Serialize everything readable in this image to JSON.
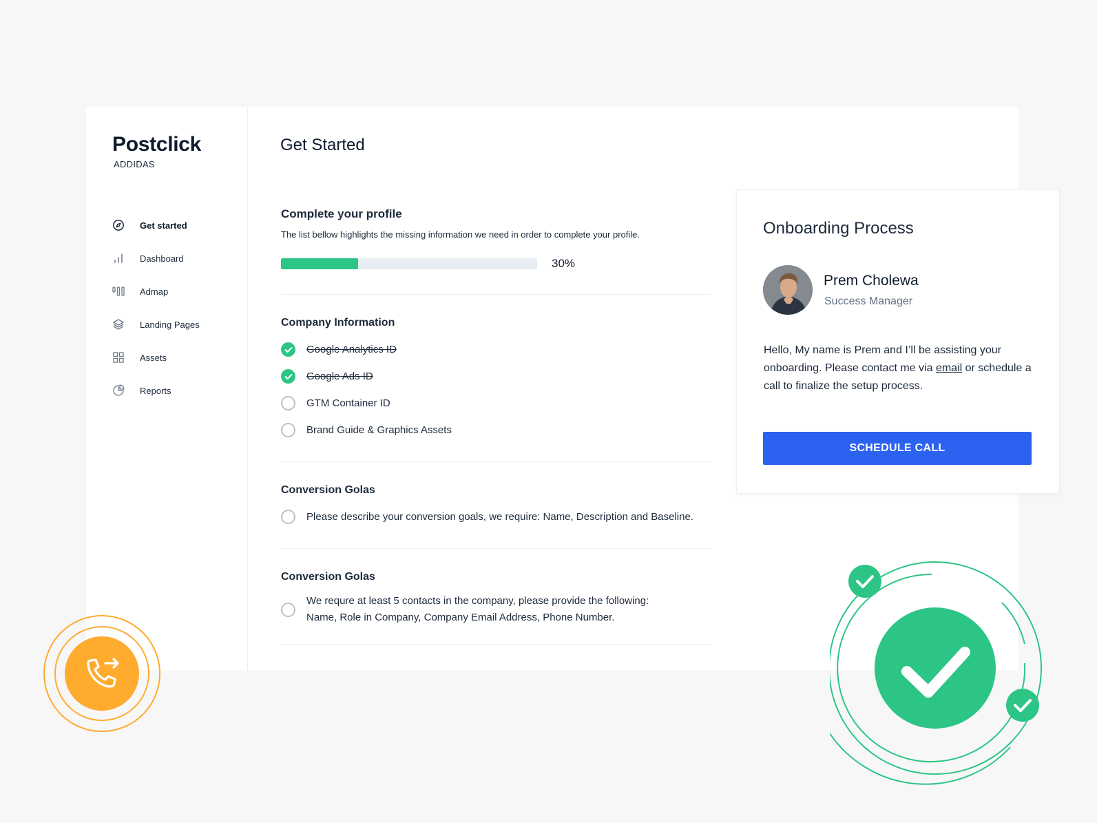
{
  "brand": {
    "name": "Postclick",
    "account": "ADDIDAS"
  },
  "sidebar": {
    "items": [
      {
        "label": "Get started",
        "icon": "compass-icon",
        "active": true
      },
      {
        "label": "Dashboard",
        "icon": "bar-chart-icon"
      },
      {
        "label": "Admap",
        "icon": "columns-icon"
      },
      {
        "label": "Landing Pages",
        "icon": "layers-icon"
      },
      {
        "label": "Assets",
        "icon": "grid-icon"
      },
      {
        "label": "Reports",
        "icon": "pie-chart-icon"
      }
    ]
  },
  "page": {
    "title": "Get Started"
  },
  "profile": {
    "title": "Complete your profile",
    "description": "The list bellow highlights the missing information we need in order to complete your profile.",
    "progress": 30,
    "progress_label": "30%"
  },
  "company": {
    "title": "Company Information",
    "items": [
      {
        "label": "Google Analytics ID",
        "done": true
      },
      {
        "label": "Google Ads ID",
        "done": true
      },
      {
        "label": "GTM Container ID",
        "done": false
      },
      {
        "label": "Brand Guide & Graphics Assets",
        "done": false
      }
    ]
  },
  "goals": {
    "title": "Conversion Golas",
    "items": [
      {
        "label": "Please describe your conversion goals, we require: Name, Description and Baseline.",
        "done": false
      }
    ]
  },
  "contacts": {
    "title": "Conversion Golas",
    "items": [
      {
        "line1": "We requre at least 5 contacts in the company, please provide the following:",
        "line2": "Name, Role in Company, Company Email Address, Phone Number.",
        "done": false
      }
    ]
  },
  "onboarding": {
    "title": "Onboarding Process",
    "name": "Prem Cholewa",
    "role": "Success Manager",
    "text_before": "Hello, My name is Prem and I’ll be assisting your onboarding. Please contact me via ",
    "link": "email",
    "text_after": " or schedule a call to finalize the setup process.",
    "button": "SCHEDULE CALL"
  },
  "colors": {
    "accent_blue": "#2b62f0",
    "success_green": "#2dc585",
    "call_orange": "#ffab2e"
  }
}
